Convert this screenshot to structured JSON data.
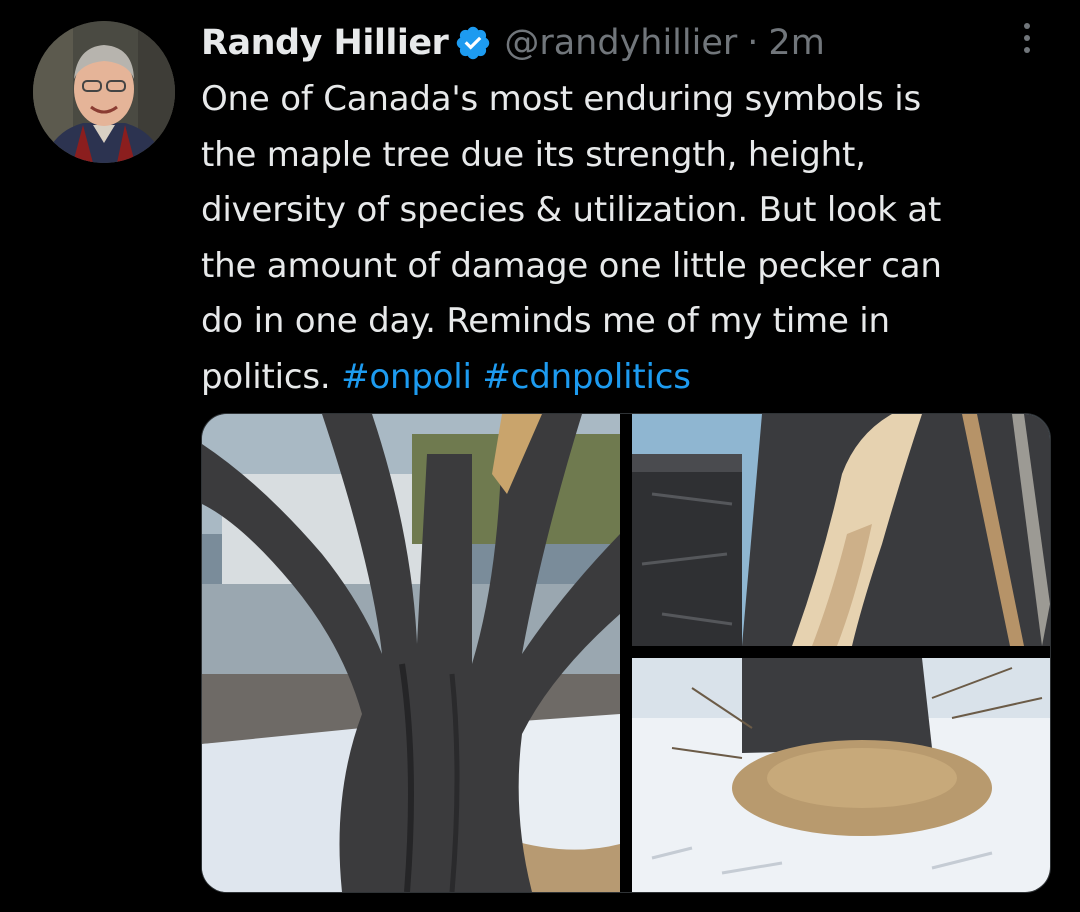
{
  "tweet": {
    "author": {
      "name": "Randy Hillier",
      "handle": "@randyhillier",
      "verified_icon": "verified-badge-icon",
      "avatar_icon": "profile-photo"
    },
    "separator": "·",
    "time": "2m",
    "more_icon": "more-options-icon",
    "text_lines": [
      "One of Canada's most enduring symbols is",
      "the maple tree due its strength, height,",
      "diversity of species & utilization. But look at",
      "the amount of damage one little pecker can",
      "do in one day. Reminds me of my time in",
      "politics. "
    ],
    "hashtags": [
      "#onpoli",
      "#cdnpolitics"
    ],
    "media": [
      {
        "icon": "photo-maple-tree-trunks-snow"
      },
      {
        "icon": "photo-woodpecker-damage-closeup"
      },
      {
        "icon": "photo-wood-chips-base-snow"
      }
    ]
  },
  "colors": {
    "background": "#000000",
    "text": "#e7e9ea",
    "secondary_text": "#71767b",
    "link": "#1d9bf0",
    "verified": "#1d9bf0"
  }
}
